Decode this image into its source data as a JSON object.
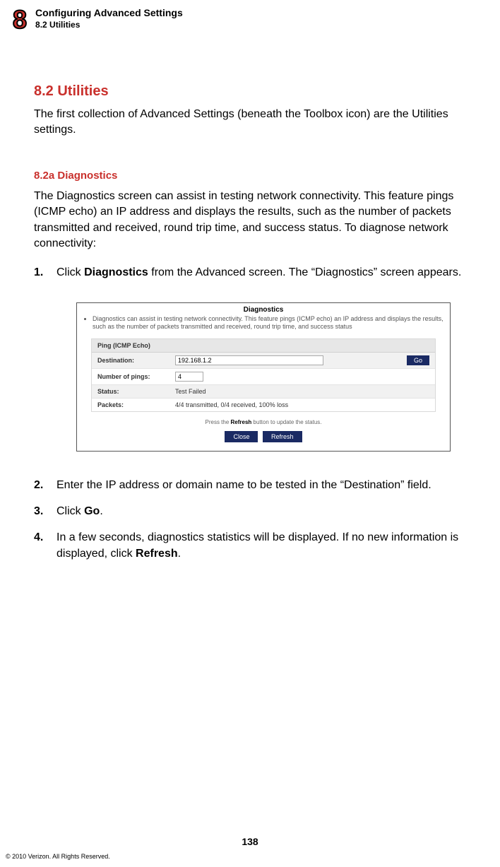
{
  "header": {
    "chapter_number": "8",
    "line1": "Configuring Advanced Settings",
    "line2": "8.2  Utilities"
  },
  "section": {
    "title": "8.2  Utilities",
    "intro": "The first collection of Advanced Settings (beneath the Toolbox icon) are the Utilities settings."
  },
  "subsection": {
    "title": "8.2a Diagnostics",
    "intro": "The Diagnostics screen can assist in testing network connectivity. This feature pings (ICMP echo) an IP address and displays the results, such as the number of packets transmitted and received, round trip time, and success status.  To diagnose network connectivity:"
  },
  "steps": {
    "s1_num": "1.",
    "s1_pre": "Click ",
    "s1_bold": "Diagnostics",
    "s1_post": " from the Advanced screen. The “Diagnostics” screen appears.",
    "s2_num": "2.",
    "s2_text": "Enter the IP address or domain name to be tested in the “Destination” field.",
    "s3_num": "3.",
    "s3_pre": "Click ",
    "s3_bold": "Go",
    "s3_post": ".",
    "s4_num": "4.",
    "s4_pre": "In a few seconds, diagnostics statistics will be displayed. If no new information is displayed, click ",
    "s4_bold": "Refresh",
    "s4_post": "."
  },
  "screenshot": {
    "title": "Diagnostics",
    "bullet": "Diagnostics can assist in testing network connectivity. This feature pings (ICMP echo) an IP address and displays the results, such as the number of packets transmitted and received, round trip time, and success status",
    "panel_head": "Ping (ICMP Echo)",
    "dest_label": "Destination:",
    "dest_value": "192.168.1.2",
    "go_label": "Go",
    "pings_label": "Number of pings:",
    "pings_value": "4",
    "status_label": "Status:",
    "status_value": "Test Failed",
    "packets_label": "Packets:",
    "packets_value": "4/4 transmitted, 0/4 received, 100% loss",
    "refresh_note_pre": "Press the ",
    "refresh_note_bold": "Refresh",
    "refresh_note_post": " button to update the status.",
    "close_btn": "Close",
    "refresh_btn": "Refresh"
  },
  "footer": {
    "page_number": "138",
    "copyright": "© 2010 Verizon. All Rights Reserved."
  }
}
